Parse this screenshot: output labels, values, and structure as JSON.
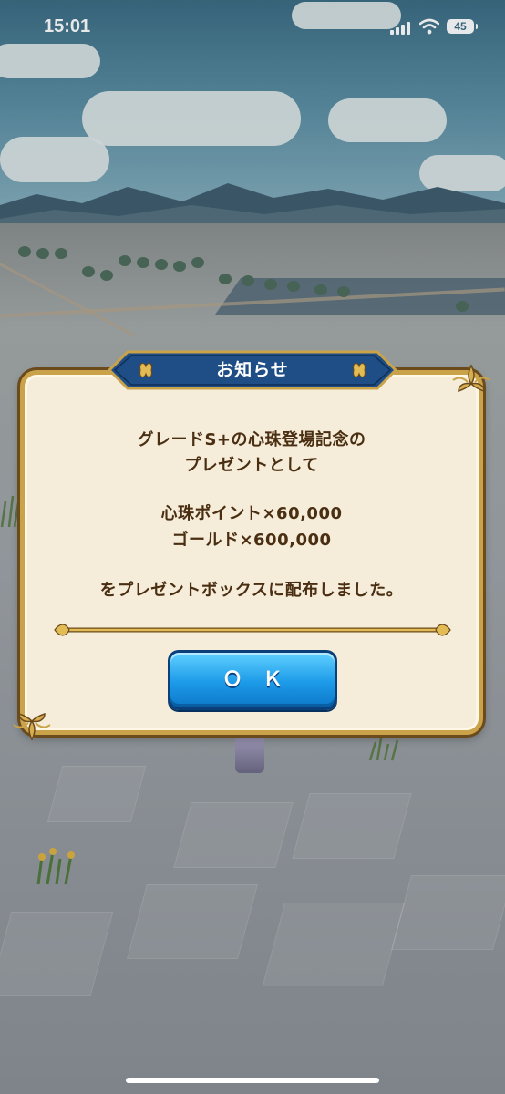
{
  "status_bar": {
    "time": "15:01",
    "battery_level": "45"
  },
  "dialog": {
    "title": "お知らせ",
    "message_line_1": "グレードS+の心珠登場記念の",
    "message_line_2": "プレゼントとして",
    "reward_line_1": "心珠ポイント×60,000",
    "reward_line_2": "ゴールド×600,000",
    "message_line_3": "をプレゼントボックスに配布しました。",
    "ok_label": "ＯＫ"
  },
  "colors": {
    "dialog_bg": "#f5edd9",
    "dialog_border": "#c9a24a",
    "banner": "#1f4e86",
    "text": "#4a2e12",
    "button": "#1c9ae8"
  }
}
